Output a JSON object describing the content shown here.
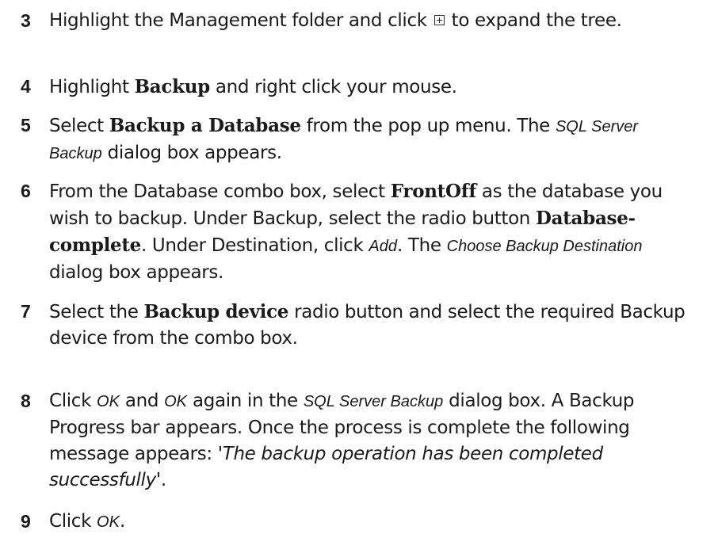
{
  "steps": [
    {
      "number": "3",
      "parts": {
        "a": "Highlight the Management folder and click ",
        "b": " to expand the tree."
      }
    },
    {
      "number": "4",
      "parts": {
        "a": "Highlight ",
        "b": "Backup",
        "c": " and right click your mouse."
      }
    },
    {
      "number": "5",
      "parts": {
        "a": "Select ",
        "b": "Backup a Database",
        "c": " from the pop up menu. The ",
        "d": "SQL Server Backup",
        "e": " dialog box appears."
      }
    },
    {
      "number": "6",
      "parts": {
        "a": "From the Database combo box, select ",
        "b": "FrontOff",
        "c": " as the database you wish to backup. Under Backup, select the radio button ",
        "d": "Database-complete",
        "e": ". Under Destination, click ",
        "f": "Add",
        "g": ". The ",
        "h": "Choose Backup Destination",
        "i": " dialog box appears."
      }
    },
    {
      "number": "7",
      "parts": {
        "a": "Select the ",
        "b": "Backup device",
        "c": " radio button and select the required Backup device from the combo box."
      }
    },
    {
      "number": "8",
      "parts": {
        "a": "Click ",
        "b": "OK",
        "c": " and ",
        "d": "OK",
        "e": " again in the ",
        "f": "SQL Server Backup",
        "g": " dialog box. A Backup Progress bar appears. Once the process is complete the following message appears: ",
        "h": "'The backup operation has been completed successfully'",
        "i": "."
      }
    },
    {
      "number": "9",
      "parts": {
        "a": "Click ",
        "b": "OK",
        "c": "."
      }
    }
  ],
  "icons": {
    "expand": "plus-box-icon"
  }
}
